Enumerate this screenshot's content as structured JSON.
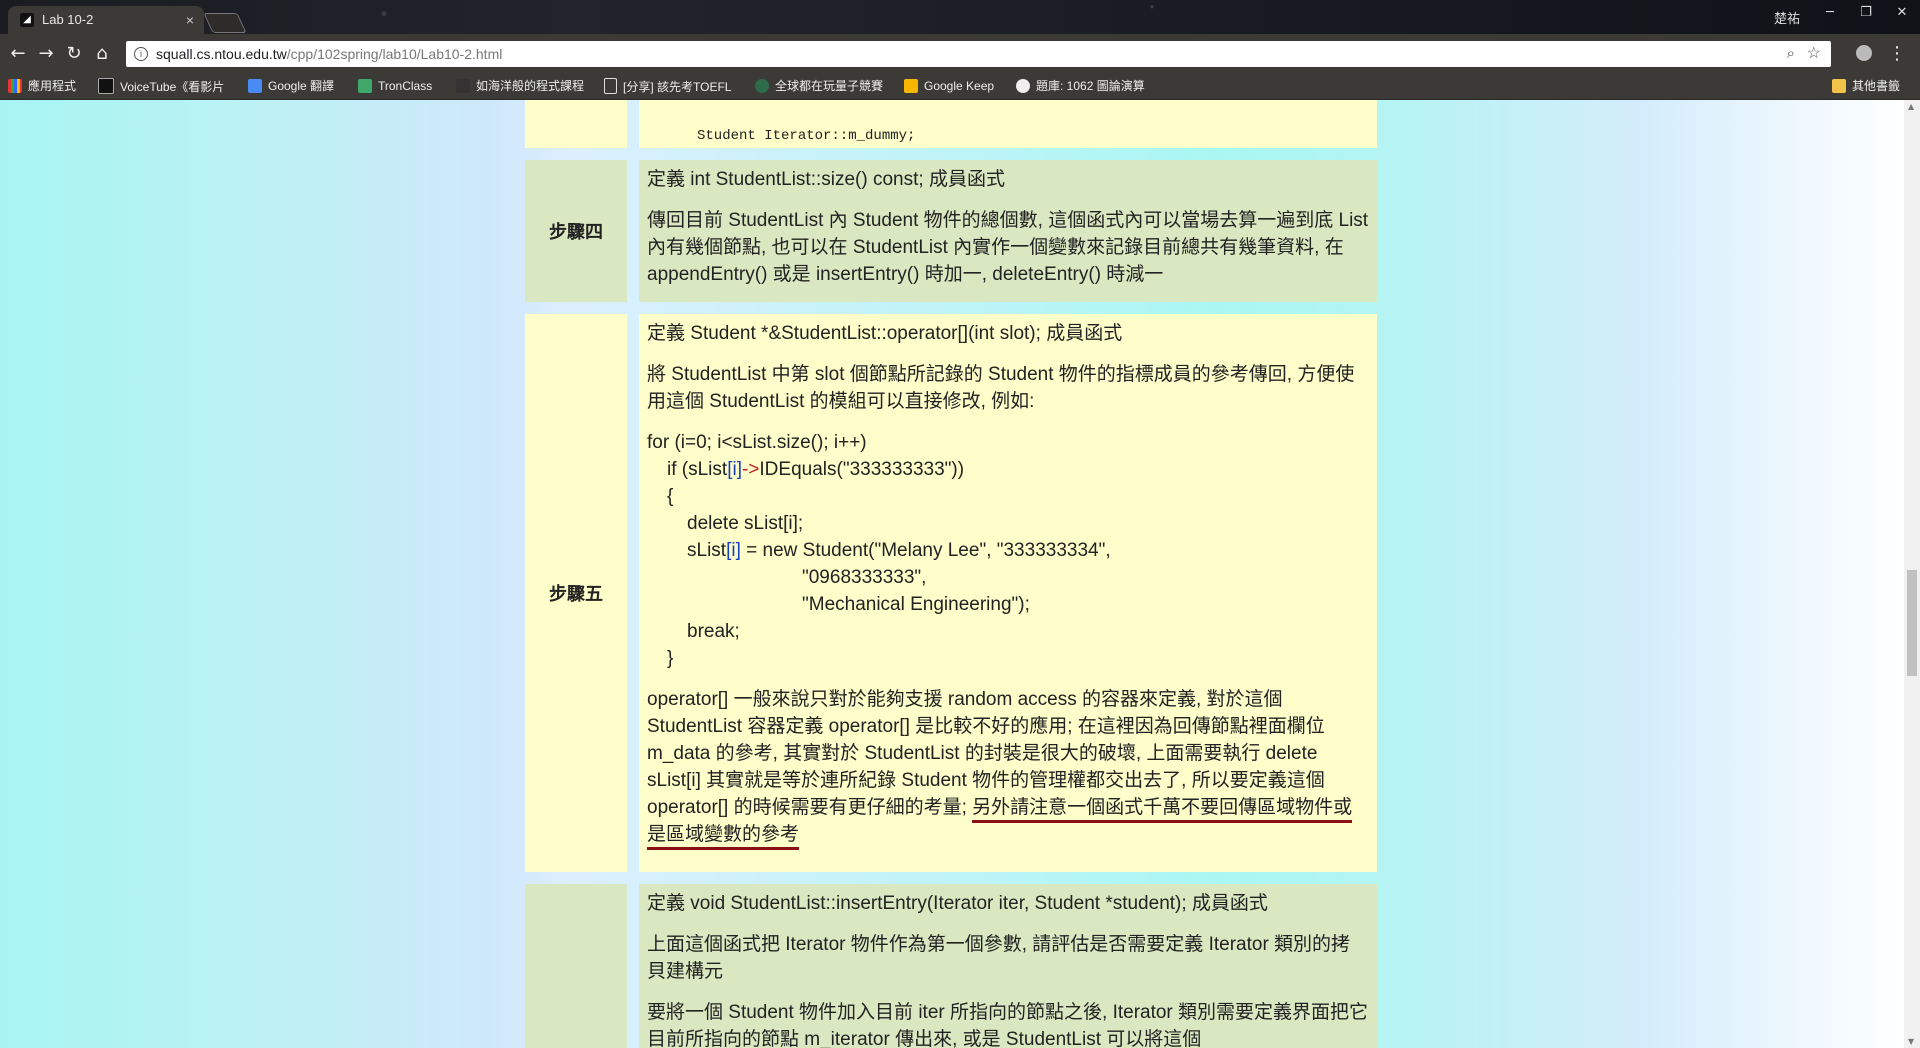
{
  "browser": {
    "tab_title": "Lab 10-2",
    "tab_close": "×",
    "user_name": "楚祐",
    "window_buttons": [
      "─",
      "❐",
      "✕"
    ],
    "url_host": "squall.cs.ntou.edu.tw",
    "url_path": "/cpp/102spring/lab10/Lab10-2.html",
    "bookmarks": [
      "應用程式",
      "VoiceTube《看影片",
      "Google 翻譯",
      "TronClass",
      "如海洋般的程式課程",
      "[分享] 該先考TOEFL",
      "全球都在玩量子競賽",
      "Google Keep",
      "題庫: 1062 圖論演算",
      "其他書籤"
    ]
  },
  "content": {
    "top_code": "Student Iterator::m_dummy;",
    "step4": {
      "label": "步驟四",
      "title": "定義 int StudentList::size() const; 成員函式",
      "body": "傳回目前 StudentList 內 Student 物件的總個數, 這個函式內可以當場去算一遍到底 List 內有幾個節點, 也可以在 StudentList 內實作一個變數來記錄目前總共有幾筆資料, 在 appendEntry() 或是 insertEntry() 時加一, deleteEntry() 時減一"
    },
    "step5": {
      "label": "步驟五",
      "title": "定義 Student *&StudentList::operator[](int slot); 成員函式",
      "body1": "將 StudentList 中第 slot 個節點所記錄的 Student 物件的指標成員的參考傳回, 方便使用這個 StudentList 的模組可以直接修改, 例如:",
      "code": {
        "l1": "for (i=0; i<sList.size(); i++)",
        "l2_pre": "if (sList",
        "l2_idx": "[i]",
        "l2_arrow": "->",
        "l2_post": "IDEquals(\"333333333\"))",
        "l3": "{",
        "l4": "delete sList[i];",
        "l5_pre": "sList",
        "l5_idx": "[i]",
        "l5_post": " = new Student(\"Melany Lee\", \"333333334\",",
        "l6": "\"0968333333\",",
        "l7": "\"Mechanical Engineering\");",
        "l8": "break;",
        "l9": "}"
      },
      "body2": "operator[] 一般來說只對於能夠支援 random access 的容器來定義, 對於這個 StudentList 容器定義 operator[] 是比較不好的應用; 在這裡因為回傳節點裡面欄位 m_data 的參考, 其實對於 StudentList 的封裝是很大的破壞, 上面需要執行 delete sList[i] 其實就是等於連所紀錄 Student 物件的管理權都交出去了, 所以要定義這個 operator[] 的時候需要有更仔細的考量; ",
      "body2_emph": "另外請注意一個函式千萬不要回傳區域物件或是區域變數的參考"
    },
    "step6": {
      "title": "定義 void StudentList::insertEntry(Iterator iter, Student *student); 成員函式",
      "body1": "上面這個函式把 Iterator 物件作為第一個參數, 請評估是否需要定義 Iterator 類別的拷貝建構元",
      "body2": "要將一個 Student 物件加入目前 iter 所指向的節點之後, Iterator 類別需要定義界面把它目前所指向的節點 m_iterator 傳出來, 或是 StudentList 可以將這個"
    }
  }
}
